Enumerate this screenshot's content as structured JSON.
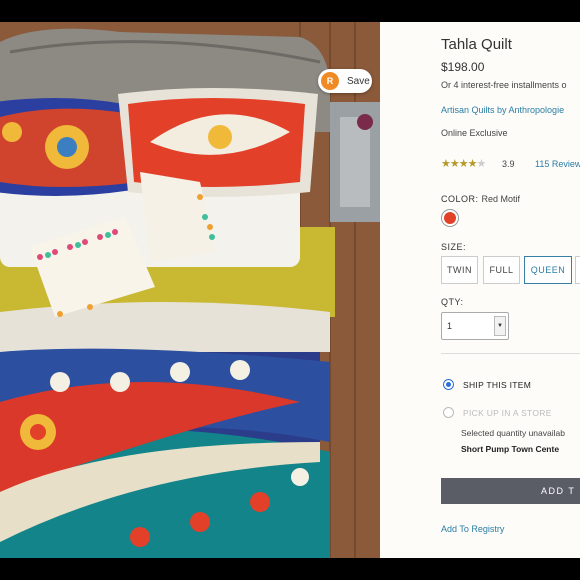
{
  "product": {
    "title": "Tahla Quilt",
    "price": "$198.00",
    "installments": "Or 4 interest-free installments o",
    "brand_link": "Artisan Quilts by Anthropologie",
    "availability": "Online Exclusive",
    "rating_value": 3.9,
    "rating_text": "3.9",
    "reviews_link": "115 Review"
  },
  "save_button": {
    "label": "Save",
    "logo_text": "R"
  },
  "color": {
    "label": "COLOR:",
    "selected": "Red Motif",
    "swatch_hex": "#e3402a"
  },
  "size": {
    "label": "SIZE:",
    "options": [
      "TWIN",
      "FULL",
      "QUEEN"
    ],
    "selected": "QUEEN"
  },
  "qty": {
    "label": "QTY:",
    "value": "1"
  },
  "fulfillment": {
    "ship_label": "SHIP THIS ITEM",
    "pickup_label": "PICK UP IN A STORE",
    "selected": "ship",
    "note": "Selected quantity unavailab",
    "store_name": "Short Pump Town Cente"
  },
  "actions": {
    "add_to_bag": "ADD T",
    "add_to_registry": "Add To Registry"
  },
  "colors": {
    "link": "#2a7da3",
    "primary_button": "#5a5d66",
    "radio_selected": "#2a6fd6",
    "star": "#b59a2a"
  }
}
